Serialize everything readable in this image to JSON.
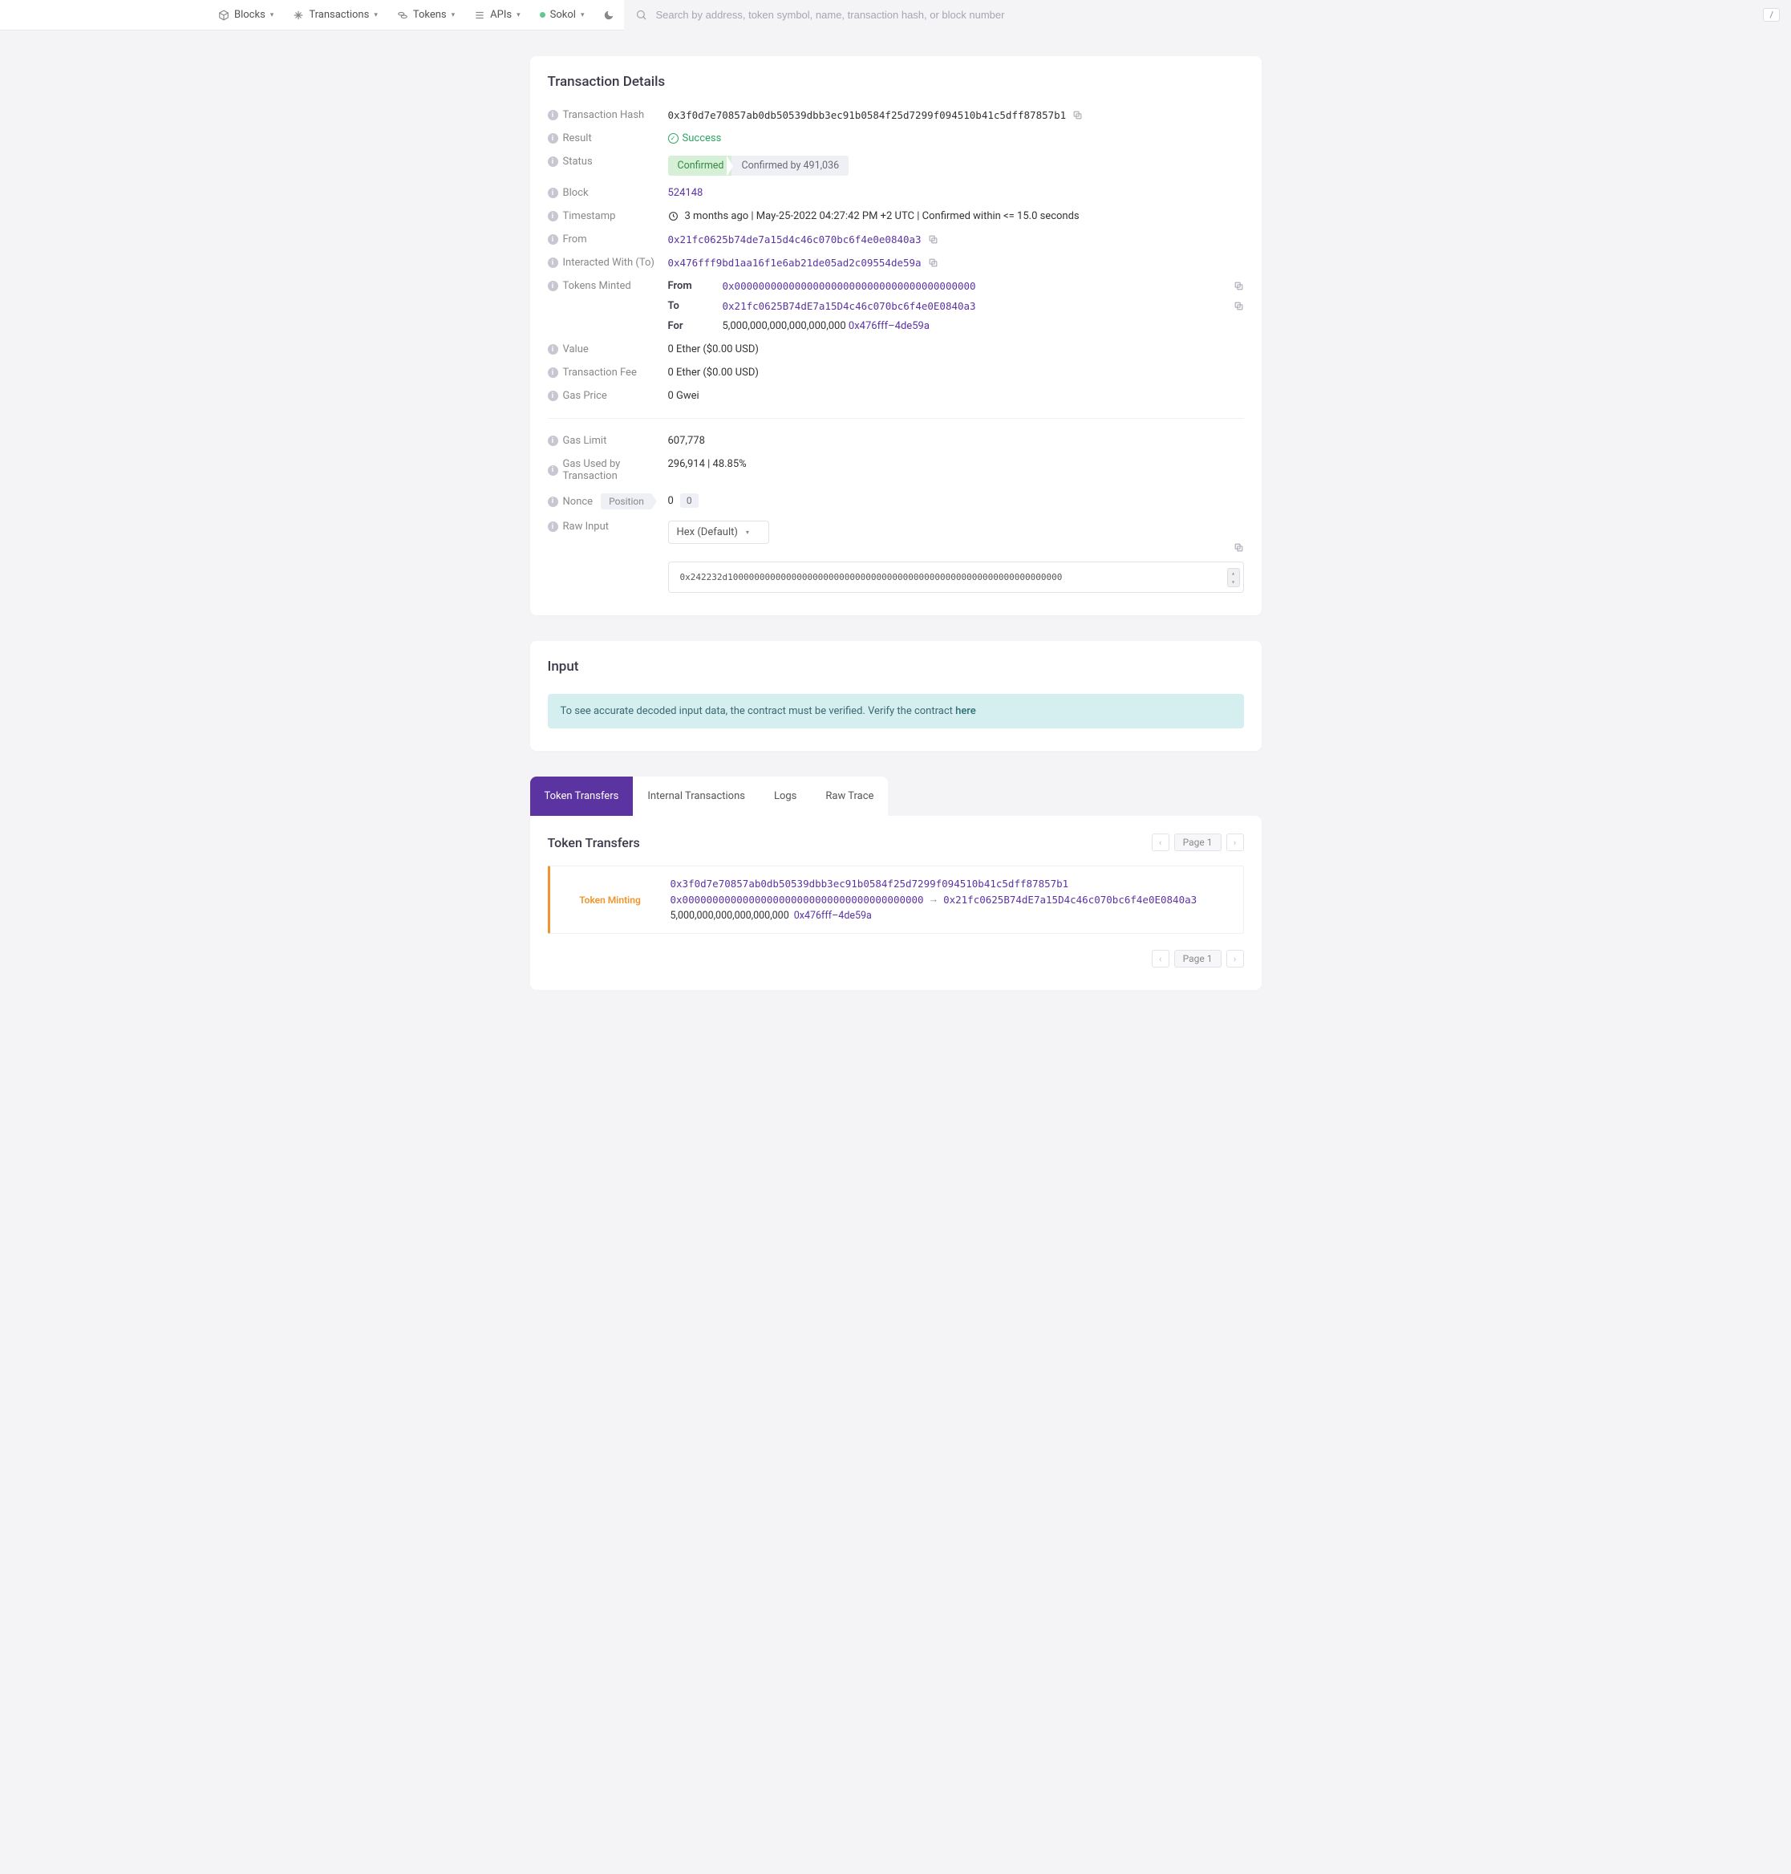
{
  "nav": {
    "blocks": "Blocks",
    "transactions": "Transactions",
    "tokens": "Tokens",
    "apis": "APIs",
    "network": "Sokol",
    "search_placeholder": "Search by address, token symbol, name, transaction hash, or block number",
    "kbd": "/"
  },
  "tx": {
    "title": "Transaction Details",
    "labels": {
      "hash": "Transaction Hash",
      "result": "Result",
      "status": "Status",
      "block": "Block",
      "timestamp": "Timestamp",
      "from": "From",
      "to": "Interacted With (To)",
      "tokens_minted": "Tokens Minted",
      "value": "Value",
      "fee": "Transaction Fee",
      "gas_price": "Gas Price",
      "gas_limit": "Gas Limit",
      "gas_used": "Gas Used by Transaction",
      "nonce": "Nonce",
      "position_label": "Position",
      "raw_input": "Raw Input"
    },
    "hash": "0x3f0d7e70857ab0db50539dbb3ec91b0584f25d7299f094510b41c5dff87857b1",
    "result": "Success",
    "status_confirmed": "Confirmed",
    "status_confirmed_by": "Confirmed by 491,036",
    "block": "524148",
    "timestamp": "3 months ago | May-25-2022 04:27:42 PM +2 UTC | Confirmed within <= 15.0 seconds",
    "from": "0x21fc0625b74de7a15d4c46c070bc6f4e0e0840a3",
    "to": "0x476fff9bd1aa16f1e6ab21de05ad2c09554de59a",
    "minted": {
      "from_label": "From",
      "to_label": "To",
      "for_label": "For",
      "from": "0x0000000000000000000000000000000000000000",
      "to": "0x21fc0625B74dE7a15D4c46c070bc6f4e0E0840a3",
      "for_amount": "5,000,000,000,000,000,000",
      "for_token": "0x476fff–4de59a"
    },
    "value": "0 Ether ($0.00 USD)",
    "fee": "0 Ether ($0.00 USD)",
    "gas_price": "0 Gwei",
    "gas_limit": "607,778",
    "gas_used": "296,914 | 48.85%",
    "nonce": "0",
    "position": "0",
    "hex_label": "Hex (Default)",
    "raw_input_value": "0x242232d100000000000000000000000000000000000000000000000000000000000000"
  },
  "input_section": {
    "title": "Input",
    "alert_text": "To see accurate decoded input data, the contract must be verified. Verify the contract ",
    "alert_link": "here"
  },
  "tabs": {
    "items": [
      "Token Transfers",
      "Internal Transactions",
      "Logs",
      "Raw Trace"
    ],
    "active": 0
  },
  "transfers": {
    "title": "Token Transfers",
    "page_label": "Page 1",
    "row": {
      "badge": "Token Minting",
      "hash": "0x3f0d7e70857ab0db50539dbb3ec91b0584f25d7299f094510b41c5dff87857b1",
      "from": "0x0000000000000000000000000000000000000000",
      "to": "0x21fc0625B74dE7a15D4c46c070bc6f4e0E0840a3",
      "amount": "5,000,000,000,000,000,000",
      "token": "0x476fff–4de59a"
    }
  }
}
